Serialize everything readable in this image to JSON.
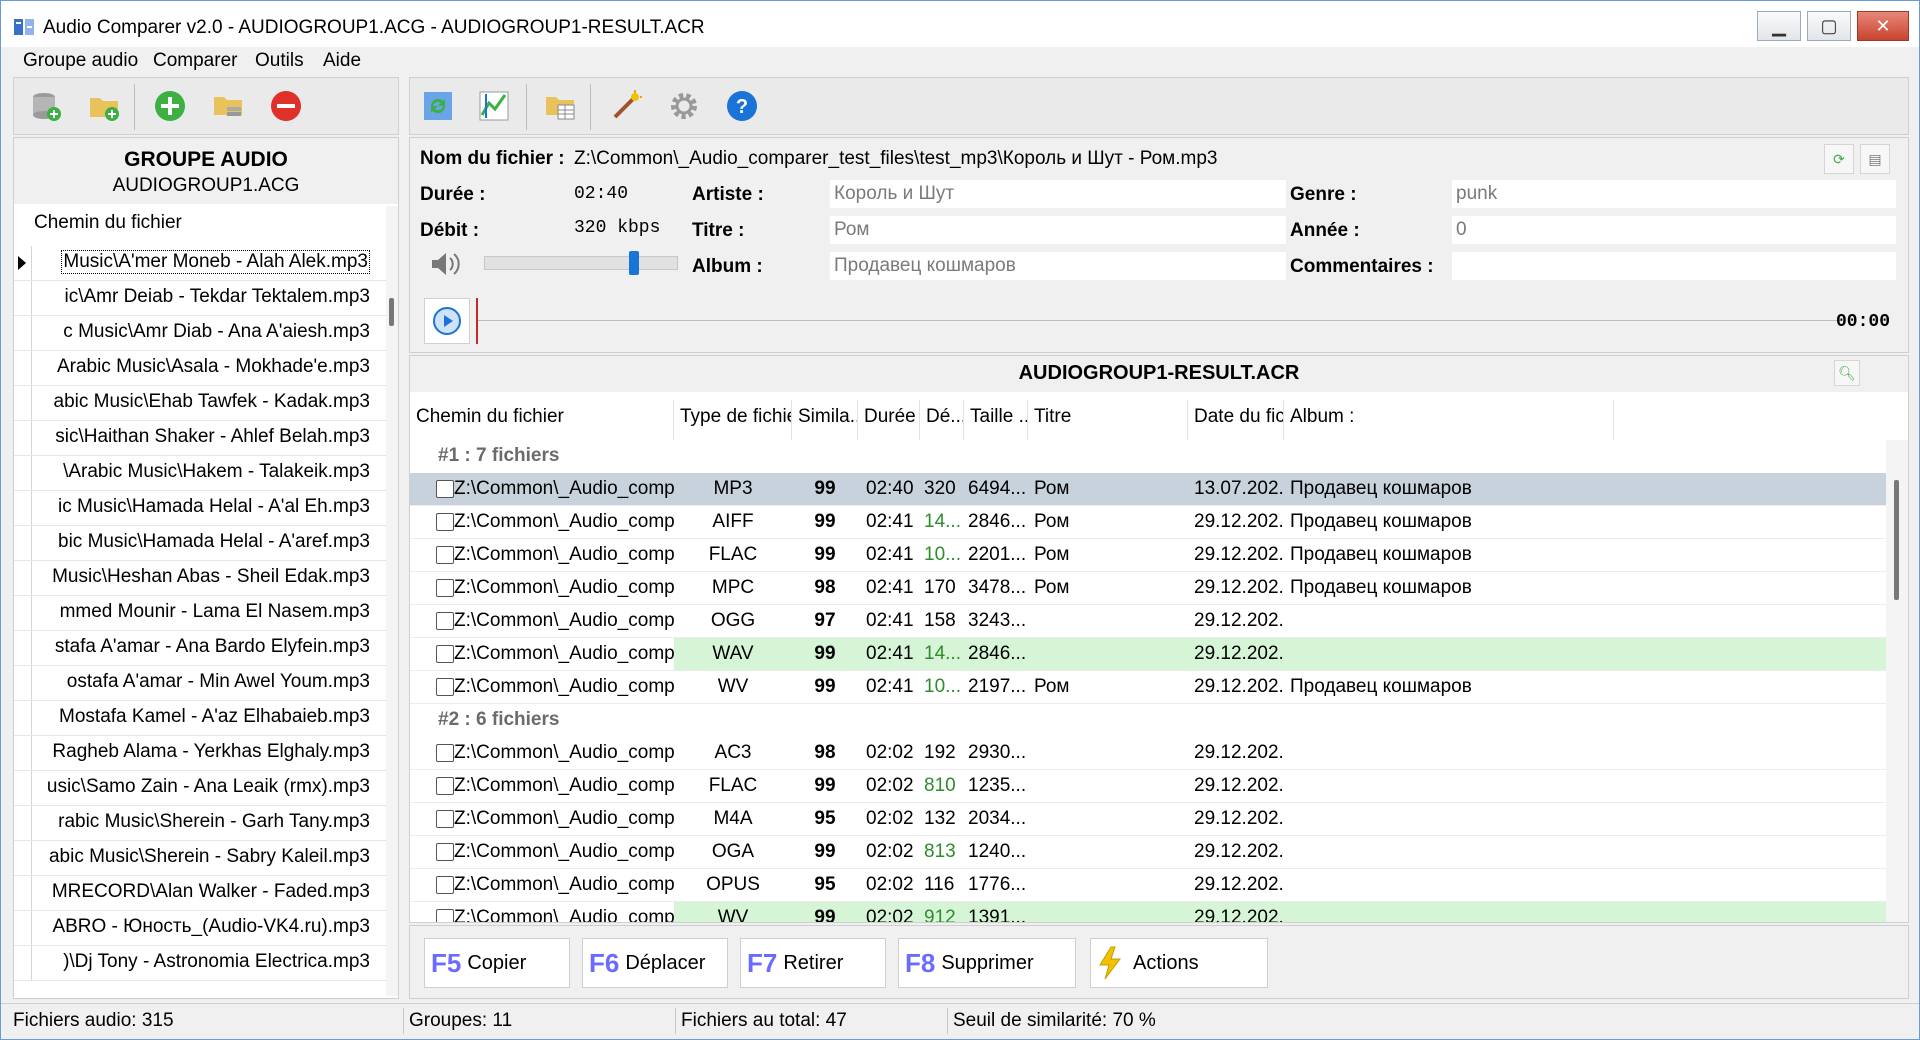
{
  "window": {
    "title": "Audio Comparer v2.0 - AUDIOGROUP1.ACG - AUDIOGROUP1-RESULT.ACR",
    "minimize": "▁",
    "maximize": "▢",
    "close": "✕"
  },
  "menu": [
    "Groupe audio",
    "Comparer",
    "Outils",
    "Aide"
  ],
  "left_toolbar": [
    "database-add-icon",
    "folder-add-icon",
    "plus-icon",
    "folder-stack-icon",
    "minus-icon"
  ],
  "main_toolbar": [
    "refresh-compare-icon",
    "chart-icon",
    "folder-grid-icon",
    "magic-wand-icon",
    "gear-icon",
    "help-icon"
  ],
  "group": {
    "title": "GROUPE AUDIO",
    "file": "AUDIOGROUP1.ACG",
    "list_header": "Chemin du fichier",
    "files": [
      "Music\\A'mer Moneb - Alah Alek.mp3",
      "ic\\Amr Deiab - Tekdar Tektalem.mp3",
      "c Music\\Amr Diab - Ana A'aiesh.mp3",
      "Arabic Music\\Asala - Mokhade'e.mp3",
      "abic Music\\Ehab Tawfek - Kadak.mp3",
      "sic\\Haithan Shaker - Ahlef Belah.mp3",
      "\\Arabic Music\\Hakem - Talakeik.mp3",
      "ic Music\\Hamada Helal - A'al Eh.mp3",
      "bic Music\\Hamada Helal - A'aref.mp3",
      "Music\\Heshan Abas - Sheil Edak.mp3",
      "mmed Mounir - Lama El Nasem.mp3",
      "stafa A'amar - Ana Bardo Elyfein.mp3",
      "ostafa A'amar - Min Awel Youm.mp3",
      "Mostafa Kamel - A'az Elhabaieb.mp3",
      "Ragheb Alama - Yerkhas Elghaly.mp3",
      "usic\\Samo Zain - Ana Leaik (rmx).mp3",
      "rabic Music\\Sherein - Garh Tany.mp3",
      "abic Music\\Sherein - Sabry Kaleil.mp3",
      "MRECORD\\Alan Walker - Faded.mp3",
      "ABRO - Юность_(Audio-VK4.ru).mp3",
      ")\\Dj Tony - Astronomia Electrica.mp3"
    ]
  },
  "info": {
    "filename_label": "Nom du fichier :",
    "filename": "Z:\\Common\\_Audio_comparer_test_files\\test_mp3\\Король и Шут - Ром.mp3",
    "duration_label": "Durée :",
    "duration": "02:40",
    "bitrate_label": "Débit :",
    "bitrate": "320 kbps",
    "artist_label": "Artiste :",
    "artist": "Король и Шут",
    "title_label": "Titre :",
    "title": "Ром",
    "album_label": "Album :",
    "album": "Продавец кошмаров",
    "genre_label": "Genre :",
    "genre": "punk",
    "year_label": "Année :",
    "year": "0",
    "comments_label": "Commentaires :",
    "comments": "",
    "volume_level": 0.78,
    "time": "00:00"
  },
  "result": {
    "title": "AUDIOGROUP1-RESULT.ACR",
    "columns": [
      "Chemin du fichier",
      "Type de fichier",
      "Simila...",
      "Durée",
      "Dé...",
      "Taille ...",
      "Titre",
      "Date du fic...",
      "Album :"
    ],
    "groups": [
      {
        "label": "#1 : 7 fichiers",
        "rows": [
          {
            "path": "Z:\\Common\\_Audio_comparer",
            "type": "MP3",
            "sim": "99",
            "dur": "02:40",
            "bit": "320",
            "size": "6494...",
            "title": "Ром",
            "date": "13.07.202...",
            "album": "Продавец кошмаров",
            "selected": true
          },
          {
            "path": "Z:\\Common\\_Audio_compar...",
            "type": "AIFF",
            "sim": "99",
            "dur": "02:41",
            "bit": "14...",
            "size": "2846...",
            "title": "Ром",
            "date": "29.12.202...",
            "album": "Продавец кошмаров",
            "bit_green": true
          },
          {
            "path": "Z:\\Common\\_Audio_compar...",
            "type": "FLAC",
            "sim": "99",
            "dur": "02:41",
            "bit": "10...",
            "size": "2201...",
            "title": "Ром",
            "date": "29.12.202...",
            "album": "Продавец кошмаров",
            "bit_green": true
          },
          {
            "path": "Z:\\Common\\_Audio_compar...",
            "type": "MPC",
            "sim": "98",
            "dur": "02:41",
            "bit": "170",
            "size": "3478...",
            "title": "Ром",
            "date": "29.12.202...",
            "album": "Продавец кошмаров"
          },
          {
            "path": "Z:\\Common\\_Audio_compar...",
            "type": "OGG",
            "sim": "97",
            "dur": "02:41",
            "bit": "158",
            "size": "3243...",
            "title": "",
            "date": "29.12.202...",
            "album": ""
          },
          {
            "path": "Z:\\Common\\_Audio_compar...",
            "type": "WAV",
            "sim": "99",
            "dur": "02:41",
            "bit": "14...",
            "size": "2846...",
            "title": "",
            "date": "29.12.202...",
            "album": "",
            "bit_green": true,
            "green_row": true
          },
          {
            "path": "Z:\\Common\\_Audio_compar...",
            "type": "WV",
            "sim": "99",
            "dur": "02:41",
            "bit": "10...",
            "size": "2197...",
            "title": "Ром",
            "date": "29.12.202...",
            "album": "Продавец кошмаров",
            "bit_green": true
          }
        ]
      },
      {
        "label": "#2 : 6 fichiers",
        "rows": [
          {
            "path": "Z:\\Common\\_Audio_compar...",
            "type": "AC3",
            "sim": "98",
            "dur": "02:02",
            "bit": "192",
            "size": "2930...",
            "title": "",
            "date": "29.12.202...",
            "album": ""
          },
          {
            "path": "Z:\\Common\\_Audio_compar...",
            "type": "FLAC",
            "sim": "99",
            "dur": "02:02",
            "bit": "810",
            "size": "1235...",
            "title": "",
            "date": "29.12.202...",
            "album": "",
            "bit_green": true
          },
          {
            "path": "Z:\\Common\\_Audio_compar...",
            "type": "M4A",
            "sim": "95",
            "dur": "02:02",
            "bit": "132",
            "size": "2034...",
            "title": "",
            "date": "29.12.202...",
            "album": ""
          },
          {
            "path": "Z:\\Common\\_Audio_compar...",
            "type": "OGA",
            "sim": "99",
            "dur": "02:02",
            "bit": "813",
            "size": "1240...",
            "title": "",
            "date": "29.12.202...",
            "album": "",
            "bit_green": true
          },
          {
            "path": "Z:\\Common\\_Audio_compar...",
            "type": "OPUS",
            "sim": "95",
            "dur": "02:02",
            "bit": "116",
            "size": "1776...",
            "title": "",
            "date": "29.12.202...",
            "album": ""
          },
          {
            "path": "Z:\\Common\\_Audio_compar...",
            "type": "WV",
            "sim": "99",
            "dur": "02:02",
            "bit": "912",
            "size": "1391...",
            "title": "",
            "date": "29.12.202...",
            "album": "",
            "bit_green": true,
            "green_row": true
          }
        ]
      }
    ]
  },
  "actions": [
    {
      "key": "F5",
      "label": "Copier"
    },
    {
      "key": "F6",
      "label": "Déplacer"
    },
    {
      "key": "F7",
      "label": "Retirer"
    },
    {
      "key": "F8",
      "label": "Supprimer"
    },
    {
      "key": "",
      "label": "Actions"
    }
  ],
  "status": {
    "audio_files": "Fichiers audio: 315",
    "groups": "Groupes: 11",
    "total": "Fichiers au total: 47",
    "threshold": "Seuil de similarité: 70 %"
  },
  "colors": {
    "accent": "#1a73d6",
    "highlight_row": "#c8d2dc",
    "green_row": "#d6f5d6",
    "green_text": "#2e8b2e",
    "fkey": "#6b6bff"
  }
}
